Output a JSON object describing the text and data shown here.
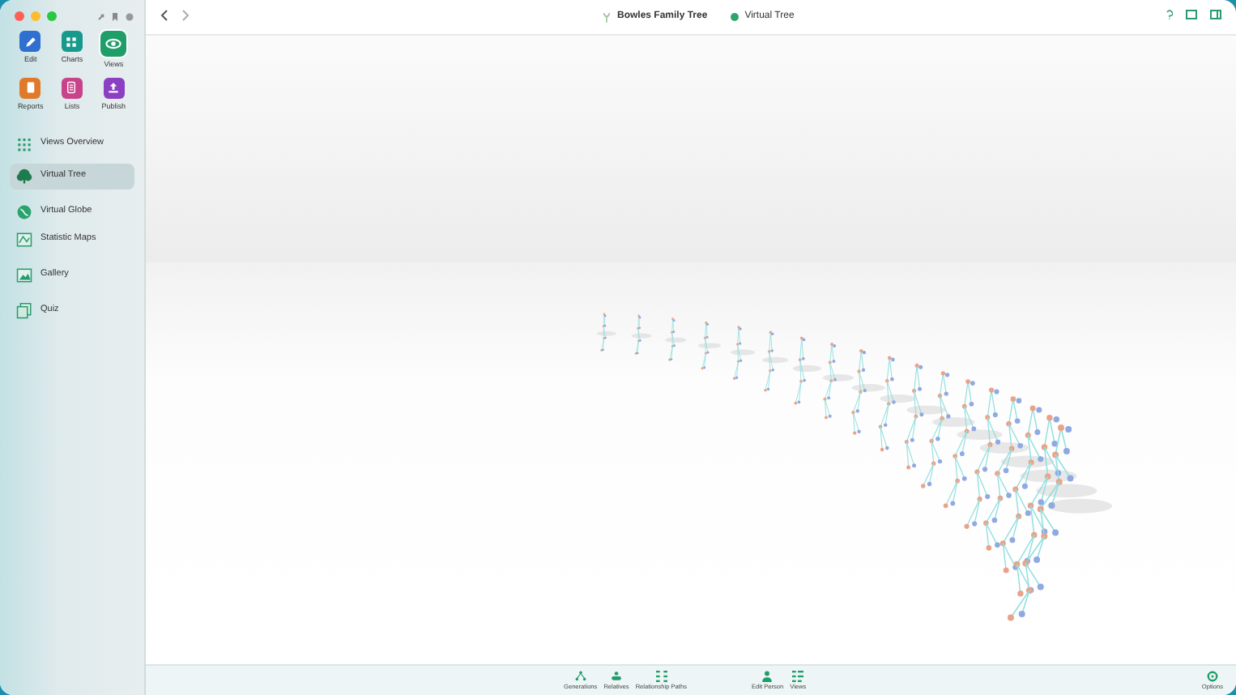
{
  "window": {
    "title": "Bowles Family Tree",
    "view_title": "Virtual Tree"
  },
  "sidebar": {
    "tools": [
      {
        "label": "Edit",
        "color": "#2f6fd0",
        "selected": false
      },
      {
        "label": "Charts",
        "color": "#179a8c",
        "selected": false
      },
      {
        "label": "Views",
        "color": "#1f9e6a",
        "selected": true
      },
      {
        "label": "Reports",
        "color": "#e07a2a",
        "selected": false
      },
      {
        "label": "Lists",
        "color": "#c8438a",
        "selected": false
      },
      {
        "label": "Publish",
        "color": "#8b3fc2",
        "selected": false
      }
    ],
    "items": [
      {
        "label": "Views Overview",
        "selected": false
      },
      {
        "label": "Virtual Tree",
        "selected": true
      },
      {
        "label": "Virtual Globe",
        "selected": false
      },
      {
        "label": "Statistic Maps",
        "selected": false
      },
      {
        "label": "Gallery",
        "selected": false
      },
      {
        "label": "Quiz",
        "selected": false
      }
    ]
  },
  "bottom_bar": {
    "buttons": [
      {
        "label": "Generations"
      },
      {
        "label": "Relatives"
      },
      {
        "label": "Relationship Paths"
      },
      {
        "label": "Edit Person"
      },
      {
        "label": "Views"
      }
    ],
    "options": "Options"
  }
}
